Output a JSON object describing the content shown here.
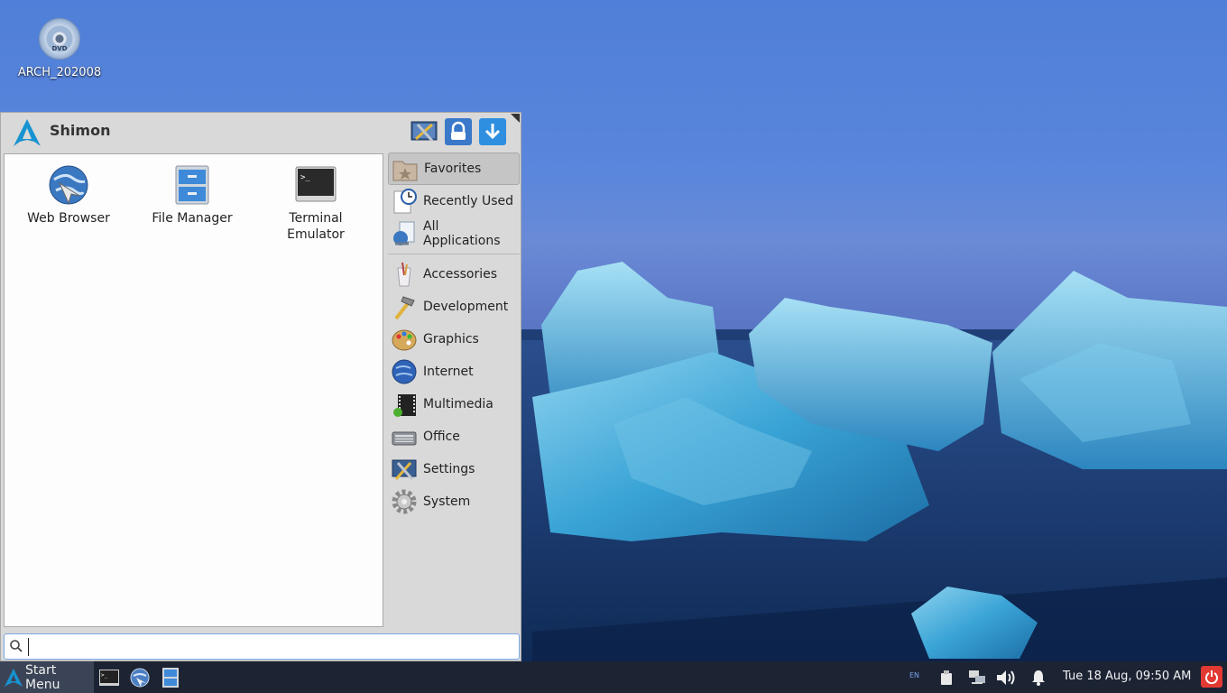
{
  "desktop": {
    "icons": [
      {
        "label": "ARCH_202008",
        "disc_text": "DVD",
        "icon": "dvd-disc-icon"
      }
    ]
  },
  "menu": {
    "user_name": "Shimon",
    "header_buttons": [
      {
        "icon": "settings-manager-icon"
      },
      {
        "icon": "lock-screen-icon"
      },
      {
        "icon": "logout-icon"
      }
    ],
    "favorites": [
      {
        "label": "Web Browser",
        "icon": "web-browser-icon"
      },
      {
        "label": "File Manager",
        "icon": "file-manager-icon"
      },
      {
        "label": "Terminal Emulator",
        "icon": "terminal-icon"
      }
    ],
    "categories_top": [
      {
        "label": "Favorites",
        "icon": "favorites-folder-icon",
        "active": true
      },
      {
        "label": "Recently Used",
        "icon": "recently-used-icon"
      },
      {
        "label": "All Applications",
        "icon": "all-applications-icon"
      }
    ],
    "categories": [
      {
        "label": "Accessories",
        "icon": "accessories-icon"
      },
      {
        "label": "Development",
        "icon": "development-hammer-icon"
      },
      {
        "label": "Graphics",
        "icon": "graphics-palette-icon"
      },
      {
        "label": "Internet",
        "icon": "internet-globe-icon"
      },
      {
        "label": "Multimedia",
        "icon": "multimedia-icon"
      },
      {
        "label": "Office",
        "icon": "office-typewriter-icon"
      },
      {
        "label": "Settings",
        "icon": "settings-icon"
      },
      {
        "label": "System",
        "icon": "system-gear-icon"
      }
    ],
    "search": {
      "value": "",
      "placeholder": ""
    }
  },
  "taskbar": {
    "start_label": "Start Menu",
    "launchers": [
      {
        "icon": "terminal-icon"
      },
      {
        "icon": "web-browser-icon"
      },
      {
        "icon": "file-manager-icon"
      }
    ],
    "keyboard_layout": "EN",
    "clock": "Tue 18 Aug, 09:50 AM"
  },
  "colors": {
    "taskbar": "#1c2434",
    "menu_bg": "#d9d9d9",
    "accent": "#2e8fe0",
    "power": "#e23a32"
  }
}
